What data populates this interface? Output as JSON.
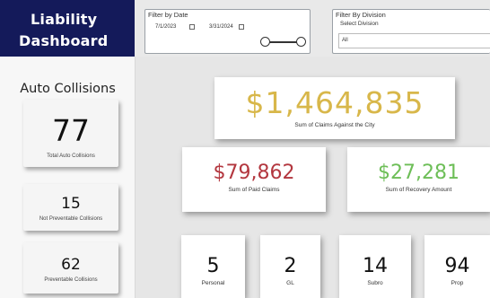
{
  "header": {
    "title_line1": "Liability",
    "title_line2": "Dashboard",
    "colors": {
      "brand": "#141a5a"
    }
  },
  "date_filter": {
    "title": "Filter by Date",
    "start_date": "7/1/2023",
    "end_date": "3/31/2024"
  },
  "division_filter": {
    "title": "Filter By Division",
    "subtitle": "Select Division",
    "selected": "All"
  },
  "sidebar": {
    "title": "Auto Collisions",
    "cards": [
      {
        "value": "77",
        "label": "Total Auto Collisions"
      },
      {
        "value": "15",
        "label": "Not Preventable Collisions"
      },
      {
        "value": "62",
        "label": "Preventable Collisions"
      }
    ]
  },
  "main": {
    "claims_total": {
      "value": "$1,464,835",
      "label": "Sum of Claims Against the City",
      "color": "#d8b74a"
    },
    "paid_claims": {
      "value": "$79,862",
      "label": "Sum of Paid Claims",
      "color": "#b3373f"
    },
    "recovery": {
      "value": "$27,281",
      "label": "Sum of Recovery Amount",
      "color": "#6dbe57"
    },
    "categories": [
      {
        "value": "5",
        "label": "Personal"
      },
      {
        "value": "2",
        "label": "GL"
      },
      {
        "value": "14",
        "label": "Subro"
      },
      {
        "value": "94",
        "label": "Prop"
      }
    ]
  }
}
